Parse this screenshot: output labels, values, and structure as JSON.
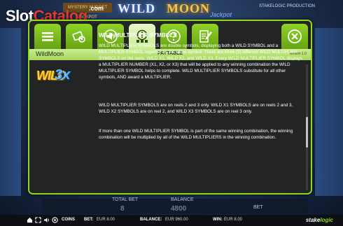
{
  "watermark": {
    "slot": "Slot",
    "catalog": "Catalog",
    "com": ".com"
  },
  "background": {
    "banner": "MYSTERY NUGGET JACKPOT",
    "logo_wild": "WILD",
    "logo_moon": "MOON",
    "logo_sub": "Jackpot",
    "topright": "STAKELOGIC PRODUCTION",
    "total_bet_label": "TOTAL BET",
    "total_bet_value": "8",
    "balance_label": "BALANCE",
    "balance_value": "4800",
    "bet_label": "BET"
  },
  "tabs": [
    {
      "name": "menu",
      "icon": "hamburger-icon",
      "active": false
    },
    {
      "name": "autoplay-settings",
      "icon": "coins-settings-icon",
      "active": false
    },
    {
      "name": "sound",
      "icon": "speaker-icon",
      "active": false
    },
    {
      "name": "paytable",
      "icon": "paytable-info-icon",
      "active": true
    },
    {
      "name": "help",
      "icon": "question-icon",
      "active": false
    },
    {
      "name": "history",
      "icon": "document-pen-icon",
      "active": false
    },
    {
      "name": "close",
      "icon": "close-icon",
      "active": false
    }
  ],
  "header": {
    "game_name": "WildMoon",
    "section": "PAYTABLE",
    "version": "version 1.0"
  },
  "symbol": {
    "wild_text": "WILD",
    "multiplier_text": "3x"
  },
  "content": {
    "title": "WILD MULTIPLIER SYMBOLS",
    "paragraph1": "WILD MULTIPLIER SYMBOLS are double symbols, displaying both a WILD SYMBOL and a MULTIPLIER SYMBOL together on the same symbol. There are three (3) different WILD MULTIPLIER SYMBOLS on the reels: WILD X1, WILD X2, and WILD X3. Every WILD MULTIPLIER SYMBOL displays a MULTIPLIER NUMBER (X1, X2, or X3) that will be applied to any winning combination the WILD MULTIPLIER SYMBOL helps to complete. WILD MULTIPLIER SYMBOLS substitute for all other symbols, AND award a MULTIPLIER.",
    "paragraph2": "WILD MULTIPLIER SYMBOLS are on reels 2 and 3 only. WILD X1 SYMBOLS are on reels 2 and 3, WILD X2 SYMBOLS are on reel 2, and WILD X3 SYMBOLS are on reel 3 only.",
    "paragraph3": "If more than one WILD MULTIPLIER SYMBOL is part of the same winning combination, the winning combination will be multiplied by all of the WILD MULTIPLIERS in the winning combination."
  },
  "scroll": {
    "position": 0.55
  },
  "statusbar": {
    "coins_label": "COINS",
    "bet_label": "BET:",
    "bet_value": "EUR 8.00",
    "balance_label": "BALANCE:",
    "balance_value": "EUR 960.00",
    "win_label": "WIN:",
    "win_value": "EUR 8.00",
    "brand_a": "stake",
    "brand_b": "logic"
  },
  "colors": {
    "accent": "#8fd81e",
    "tab_green": "#7cc020",
    "tab_active": "#dff3bd",
    "panel_bg": "#222524",
    "header_bar": "#b8e07a",
    "watermark_red": "#e23b2e"
  }
}
